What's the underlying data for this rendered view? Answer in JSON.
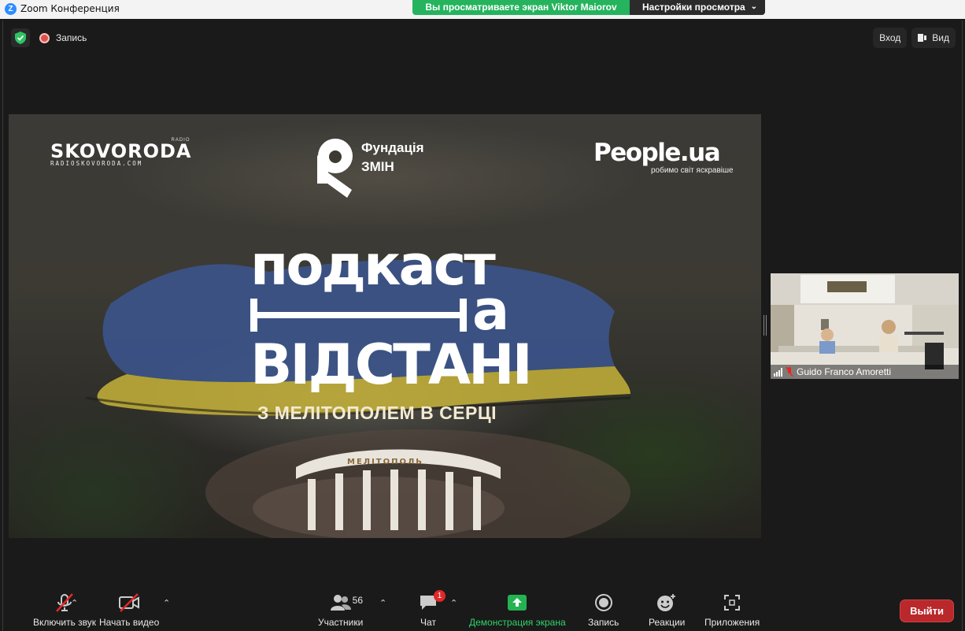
{
  "window": {
    "title": "Zoom Конференция",
    "logo_letter": "Z"
  },
  "share_banner": {
    "viewing_text": "Вы просматриваете экран Viktor Maiorov",
    "view_settings_label": "Настройки просмотра"
  },
  "top_bar": {
    "recording_label": "Запись",
    "enter_label": "Вход",
    "view_label": "Вид"
  },
  "slide": {
    "skovoroda_logo": "SKOVORODA",
    "skovoroda_radio": "RADIO",
    "skovoroda_site": "RADIOSKOVORODA.COM",
    "fund_name_line1": "Фундація",
    "fund_name_line2": "ЗМІН",
    "people_logo": "People.ua",
    "people_tagline": "робимо світ яскравіше",
    "headline_line1": "подкаст",
    "headline_line2": "а",
    "headline_line3": "ВІДСТАНІ",
    "subheadline": "З МЕЛІТОПОЛЕМ В СЕРЦІ",
    "arch_text": "МЕЛІТОПОЛЬ"
  },
  "participant": {
    "name": "Guido Franco Amoretti"
  },
  "toolbar": {
    "audio_label": "Включить звук",
    "video_label": "Начать видео",
    "participants_label": "Участники",
    "participants_count": "56",
    "chat_label": "Чат",
    "chat_badge": "1",
    "share_label": "Демонстрация экрана",
    "record_label": "Запись",
    "reactions_label": "Реакции",
    "apps_label": "Приложения",
    "leave_label": "Выйти"
  },
  "colors": {
    "share_green": "#25b35e",
    "leave_red": "#b9282b",
    "flag_blue": "#3a5a9a",
    "flag_yellow": "#c9b43a"
  }
}
